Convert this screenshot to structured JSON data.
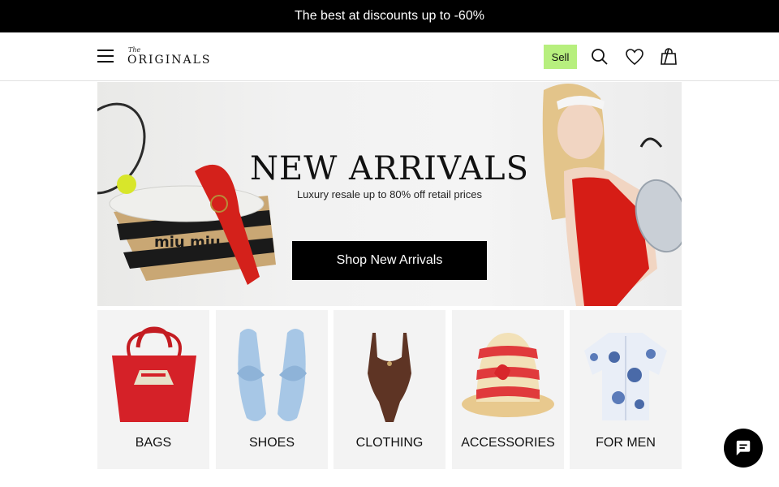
{
  "promo": {
    "text": "The best at discounts up to -60%"
  },
  "header": {
    "logo_small": "The",
    "logo_main": "ORIGINALS",
    "sell_label": "Sell",
    "sell_color": "#b7ef7e",
    "icons": [
      "menu-icon",
      "search-icon",
      "heart-icon",
      "shopping-bag-icon"
    ]
  },
  "hero": {
    "title": "NEW ARRIVALS",
    "subtitle": "Luxury resale up to 80% off retail prices",
    "cta": "Shop New Arrivals",
    "bag_text": "miu miu"
  },
  "categories": [
    {
      "label": "BAGS"
    },
    {
      "label": "SHOES"
    },
    {
      "label": "CLOTHING"
    },
    {
      "label": "ACCESSORIES"
    },
    {
      "label": "FOR MEN"
    }
  ],
  "chat": {
    "icon": "chat-icon"
  }
}
